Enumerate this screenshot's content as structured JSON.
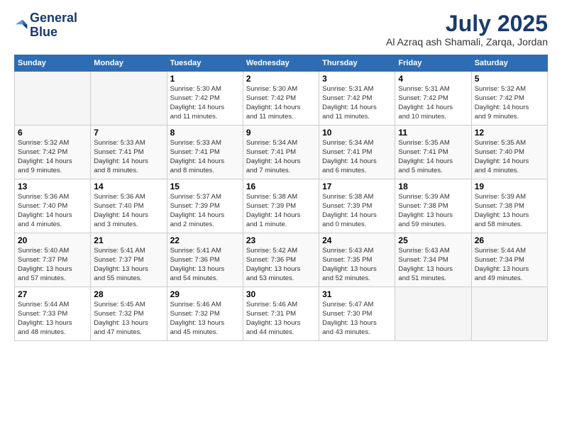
{
  "logo": {
    "line1": "General",
    "line2": "Blue"
  },
  "title": "July 2025",
  "subtitle": "Al Azraq ash Shamali, Zarqa, Jordan",
  "weekdays": [
    "Sunday",
    "Monday",
    "Tuesday",
    "Wednesday",
    "Thursday",
    "Friday",
    "Saturday"
  ],
  "weeks": [
    [
      {
        "day": "",
        "info": ""
      },
      {
        "day": "",
        "info": ""
      },
      {
        "day": "1",
        "info": "Sunrise: 5:30 AM\nSunset: 7:42 PM\nDaylight: 14 hours\nand 11 minutes."
      },
      {
        "day": "2",
        "info": "Sunrise: 5:30 AM\nSunset: 7:42 PM\nDaylight: 14 hours\nand 11 minutes."
      },
      {
        "day": "3",
        "info": "Sunrise: 5:31 AM\nSunset: 7:42 PM\nDaylight: 14 hours\nand 11 minutes."
      },
      {
        "day": "4",
        "info": "Sunrise: 5:31 AM\nSunset: 7:42 PM\nDaylight: 14 hours\nand 10 minutes."
      },
      {
        "day": "5",
        "info": "Sunrise: 5:32 AM\nSunset: 7:42 PM\nDaylight: 14 hours\nand 9 minutes."
      }
    ],
    [
      {
        "day": "6",
        "info": "Sunrise: 5:32 AM\nSunset: 7:42 PM\nDaylight: 14 hours\nand 9 minutes."
      },
      {
        "day": "7",
        "info": "Sunrise: 5:33 AM\nSunset: 7:41 PM\nDaylight: 14 hours\nand 8 minutes."
      },
      {
        "day": "8",
        "info": "Sunrise: 5:33 AM\nSunset: 7:41 PM\nDaylight: 14 hours\nand 8 minutes."
      },
      {
        "day": "9",
        "info": "Sunrise: 5:34 AM\nSunset: 7:41 PM\nDaylight: 14 hours\nand 7 minutes."
      },
      {
        "day": "10",
        "info": "Sunrise: 5:34 AM\nSunset: 7:41 PM\nDaylight: 14 hours\nand 6 minutes."
      },
      {
        "day": "11",
        "info": "Sunrise: 5:35 AM\nSunset: 7:41 PM\nDaylight: 14 hours\nand 5 minutes."
      },
      {
        "day": "12",
        "info": "Sunrise: 5:35 AM\nSunset: 7:40 PM\nDaylight: 14 hours\nand 4 minutes."
      }
    ],
    [
      {
        "day": "13",
        "info": "Sunrise: 5:36 AM\nSunset: 7:40 PM\nDaylight: 14 hours\nand 4 minutes."
      },
      {
        "day": "14",
        "info": "Sunrise: 5:36 AM\nSunset: 7:40 PM\nDaylight: 14 hours\nand 3 minutes."
      },
      {
        "day": "15",
        "info": "Sunrise: 5:37 AM\nSunset: 7:39 PM\nDaylight: 14 hours\nand 2 minutes."
      },
      {
        "day": "16",
        "info": "Sunrise: 5:38 AM\nSunset: 7:39 PM\nDaylight: 14 hours\nand 1 minute."
      },
      {
        "day": "17",
        "info": "Sunrise: 5:38 AM\nSunset: 7:39 PM\nDaylight: 14 hours\nand 0 minutes."
      },
      {
        "day": "18",
        "info": "Sunrise: 5:39 AM\nSunset: 7:38 PM\nDaylight: 13 hours\nand 59 minutes."
      },
      {
        "day": "19",
        "info": "Sunrise: 5:39 AM\nSunset: 7:38 PM\nDaylight: 13 hours\nand 58 minutes."
      }
    ],
    [
      {
        "day": "20",
        "info": "Sunrise: 5:40 AM\nSunset: 7:37 PM\nDaylight: 13 hours\nand 57 minutes."
      },
      {
        "day": "21",
        "info": "Sunrise: 5:41 AM\nSunset: 7:37 PM\nDaylight: 13 hours\nand 55 minutes."
      },
      {
        "day": "22",
        "info": "Sunrise: 5:41 AM\nSunset: 7:36 PM\nDaylight: 13 hours\nand 54 minutes."
      },
      {
        "day": "23",
        "info": "Sunrise: 5:42 AM\nSunset: 7:36 PM\nDaylight: 13 hours\nand 53 minutes."
      },
      {
        "day": "24",
        "info": "Sunrise: 5:43 AM\nSunset: 7:35 PM\nDaylight: 13 hours\nand 52 minutes."
      },
      {
        "day": "25",
        "info": "Sunrise: 5:43 AM\nSunset: 7:34 PM\nDaylight: 13 hours\nand 51 minutes."
      },
      {
        "day": "26",
        "info": "Sunrise: 5:44 AM\nSunset: 7:34 PM\nDaylight: 13 hours\nand 49 minutes."
      }
    ],
    [
      {
        "day": "27",
        "info": "Sunrise: 5:44 AM\nSunset: 7:33 PM\nDaylight: 13 hours\nand 48 minutes."
      },
      {
        "day": "28",
        "info": "Sunrise: 5:45 AM\nSunset: 7:32 PM\nDaylight: 13 hours\nand 47 minutes."
      },
      {
        "day": "29",
        "info": "Sunrise: 5:46 AM\nSunset: 7:32 PM\nDaylight: 13 hours\nand 45 minutes."
      },
      {
        "day": "30",
        "info": "Sunrise: 5:46 AM\nSunset: 7:31 PM\nDaylight: 13 hours\nand 44 minutes."
      },
      {
        "day": "31",
        "info": "Sunrise: 5:47 AM\nSunset: 7:30 PM\nDaylight: 13 hours\nand 43 minutes."
      },
      {
        "day": "",
        "info": ""
      },
      {
        "day": "",
        "info": ""
      }
    ]
  ]
}
